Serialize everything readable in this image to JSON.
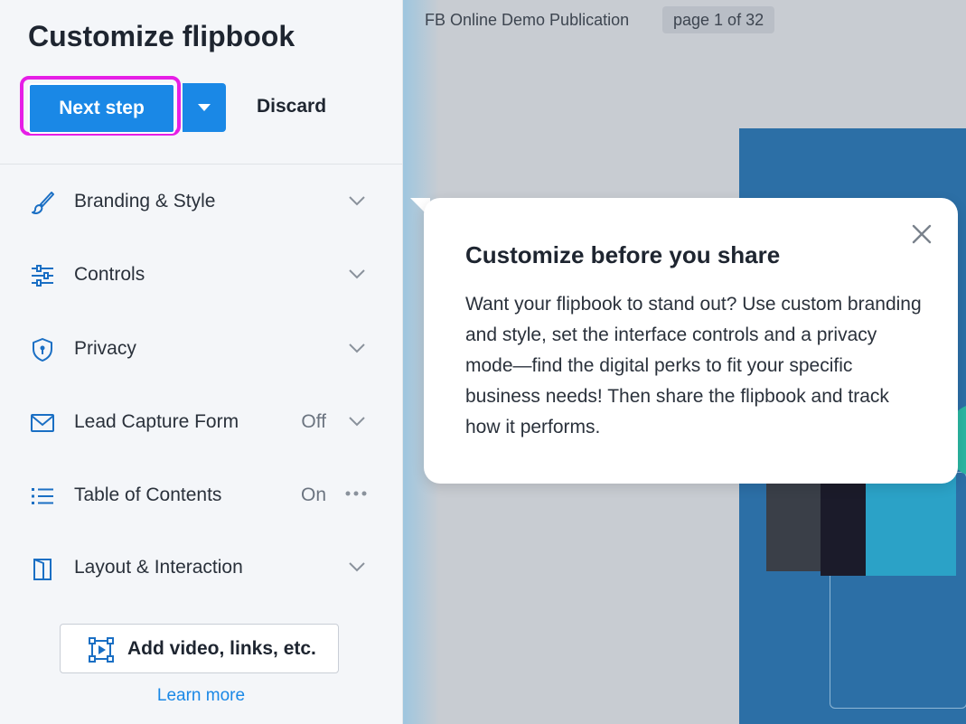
{
  "sidebar": {
    "title": "Customize flipbook",
    "next_label": "Next step",
    "discard_label": "Discard",
    "items": [
      {
        "label": "Branding & Style",
        "status": "",
        "icon": "brush-icon"
      },
      {
        "label": "Controls",
        "status": "",
        "icon": "sliders-icon"
      },
      {
        "label": "Privacy",
        "status": "",
        "icon": "shield-icon"
      },
      {
        "label": "Lead Capture Form",
        "status": "Off",
        "icon": "envelope-icon"
      },
      {
        "label": "Table of Contents",
        "status": "On",
        "icon": "list-icon"
      },
      {
        "label": "Layout & Interaction",
        "status": "",
        "icon": "book-icon"
      }
    ],
    "add_label": "Add video, links, etc.",
    "learn_more": "Learn more"
  },
  "viewer": {
    "publication_title": "FB Online Demo Publication",
    "page_indicator": "page 1 of 32"
  },
  "popover": {
    "title": "Customize before you share",
    "body": "Want your flipbook to stand out? Use custom branding and style, set the interface controls and a privacy mode—find the digital perks to fit your specific business needs! Then share the flipbook and track how it performs."
  },
  "colors": {
    "accent": "#1a88e6",
    "highlight": "#e61ee6"
  }
}
